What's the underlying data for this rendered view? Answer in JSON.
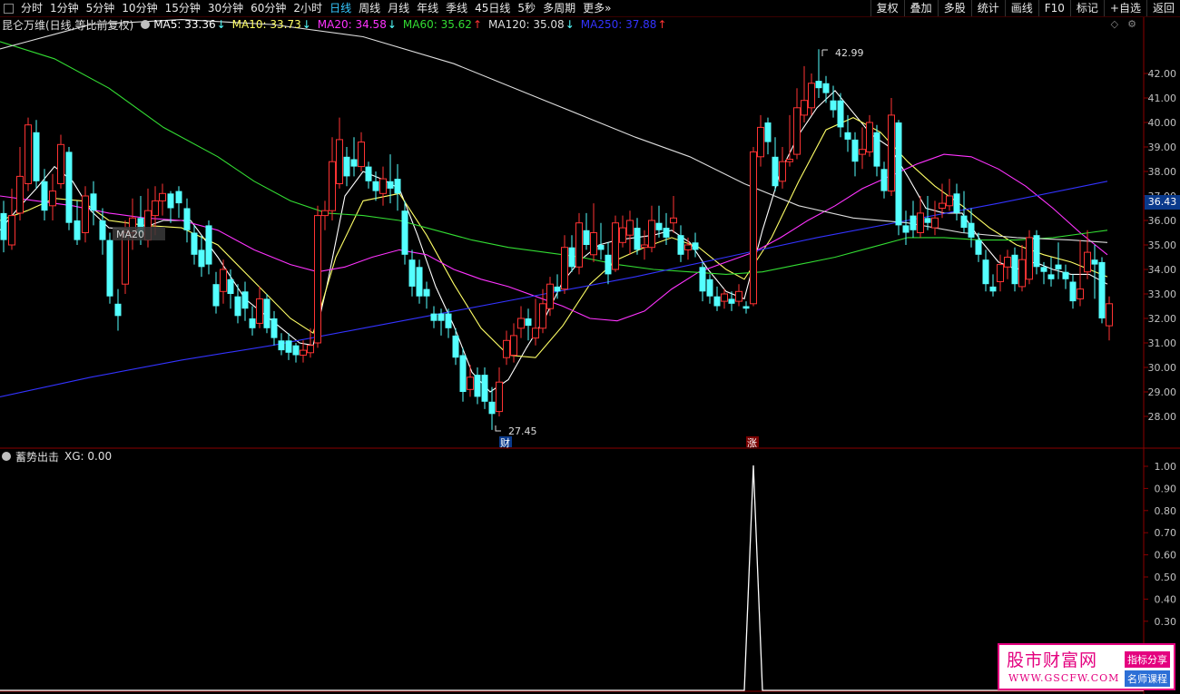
{
  "toolbar": {
    "periods": [
      "分时",
      "1分钟",
      "5分钟",
      "10分钟",
      "15分钟",
      "30分钟",
      "60分钟",
      "2小时",
      "日线",
      "周线",
      "月线",
      "年线",
      "季线",
      "45日线",
      "5秒",
      "多周期",
      "更多"
    ],
    "active_index": 8,
    "right_buttons": [
      "复权",
      "叠加",
      "多股",
      "统计",
      "画线",
      "F10",
      "标记",
      "+自选",
      "返回"
    ]
  },
  "main_legend": {
    "title": "昆仑万维(日线,等比前复权)",
    "items": [
      {
        "text": "MA5: 33.36",
        "arrow": "↓",
        "color": "#ffffff"
      },
      {
        "text": "MA10: 33.73",
        "arrow": "↓",
        "color": "#ffff66"
      },
      {
        "text": "MA20: 34.58",
        "arrow": "↓",
        "color": "#ff33ff"
      },
      {
        "text": "MA60: 35.62",
        "arrow": "↑",
        "color": "#33dd33"
      },
      {
        "text": "MA120: 35.08",
        "arrow": "↓",
        "color": "#dddddd"
      },
      {
        "text": "MA250: 37.88",
        "arrow": "↑",
        "color": "#3333ff"
      }
    ]
  },
  "sub_legend": {
    "title": "蓄势出击",
    "item": "XG: 0.00"
  },
  "price_axis": [
    "42.00",
    "41.00",
    "40.00",
    "39.00",
    "38.00",
    "37.00",
    "36.00",
    "35.00",
    "34.00",
    "33.00",
    "32.00",
    "31.00",
    "30.00",
    "29.00",
    "28.00"
  ],
  "sub_axis": [
    "1.00",
    "0.90",
    "0.80",
    "0.70",
    "0.60",
    "0.50",
    "0.40",
    "0.30"
  ],
  "current_price": "36.43",
  "annotations": {
    "high": "42.99",
    "low": "27.45",
    "marker_cai": "财",
    "marker_zhang": "涨",
    "overlay_label": "MA20"
  },
  "colors": {
    "up": "#ff3333",
    "down": "#54ffff",
    "ma5": "#ffffff",
    "ma10": "#ffff66",
    "ma20": "#ff33ff",
    "ma60": "#33dd33",
    "ma120": "#dddddd",
    "ma250": "#3333ff"
  },
  "watermark": {
    "title": "股市财富网",
    "url": "WWW.GSCFW.COM",
    "badge1": "指标分享",
    "badge2": "名师课程"
  }
}
